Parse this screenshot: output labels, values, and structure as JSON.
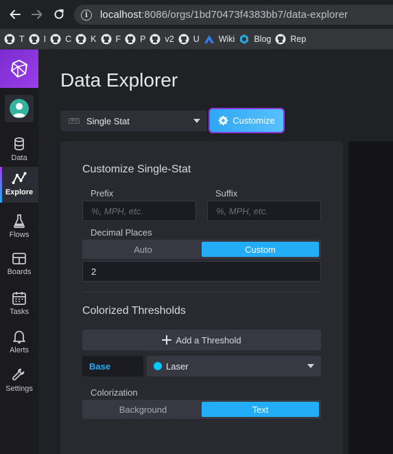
{
  "browser": {
    "url_host": "localhost",
    "url_rest": ":8086/orgs/1bd70473f4383bb7/data-explorer",
    "bookmarks": [
      {
        "label": "T",
        "icon": "github-icon"
      },
      {
        "label": "I",
        "icon": "github-icon"
      },
      {
        "label": "C",
        "icon": "github-icon"
      },
      {
        "label": "K",
        "icon": "github-icon"
      },
      {
        "label": "F",
        "icon": "github-icon"
      },
      {
        "label": "P",
        "icon": "github-icon"
      },
      {
        "label": "v2",
        "icon": "github-icon"
      },
      {
        "label": "U",
        "icon": "github-icon"
      },
      {
        "label": "Wiki",
        "icon": "confluence-icon"
      },
      {
        "label": "Blog",
        "icon": "hexagon-icon"
      },
      {
        "label": "Rep",
        "icon": "github-icon"
      }
    ]
  },
  "sidebar": {
    "items": [
      {
        "label": "Data",
        "icon": "database-icon"
      },
      {
        "label": "Explore",
        "icon": "graph-icon",
        "active": true
      },
      {
        "label": "Flows",
        "icon": "flask-icon"
      },
      {
        "label": "Boards",
        "icon": "dashboard-icon"
      },
      {
        "label": "Tasks",
        "icon": "calendar-icon"
      },
      {
        "label": "Alerts",
        "icon": "bell-icon"
      },
      {
        "label": "Settings",
        "icon": "wrench-icon"
      }
    ]
  },
  "main": {
    "title": "Data Explorer",
    "viz_type": "Single Stat",
    "customize_label": "Customize"
  },
  "customize": {
    "title": "Customize Single-Stat",
    "prefix_label": "Prefix",
    "prefix_placeholder": "%, MPH, etc.",
    "suffix_label": "Suffix",
    "suffix_placeholder": "%, MPH, etc.",
    "decimal_label": "Decimal Places",
    "decimal_options": [
      "Auto",
      "Custom"
    ],
    "decimal_selected": "Custom",
    "decimal_value": "2",
    "thresholds_title": "Colorized Thresholds",
    "add_threshold_label": "Add a Threshold",
    "base_label": "Base",
    "base_color_name": "Laser",
    "base_color_hex": "#00c9ff",
    "colorization_label": "Colorization",
    "colorization_options": [
      "Background",
      "Text"
    ],
    "colorization_selected": "Text"
  },
  "colors": {
    "accent": "#22adf6",
    "brand_purple": "#9b3ee8"
  }
}
